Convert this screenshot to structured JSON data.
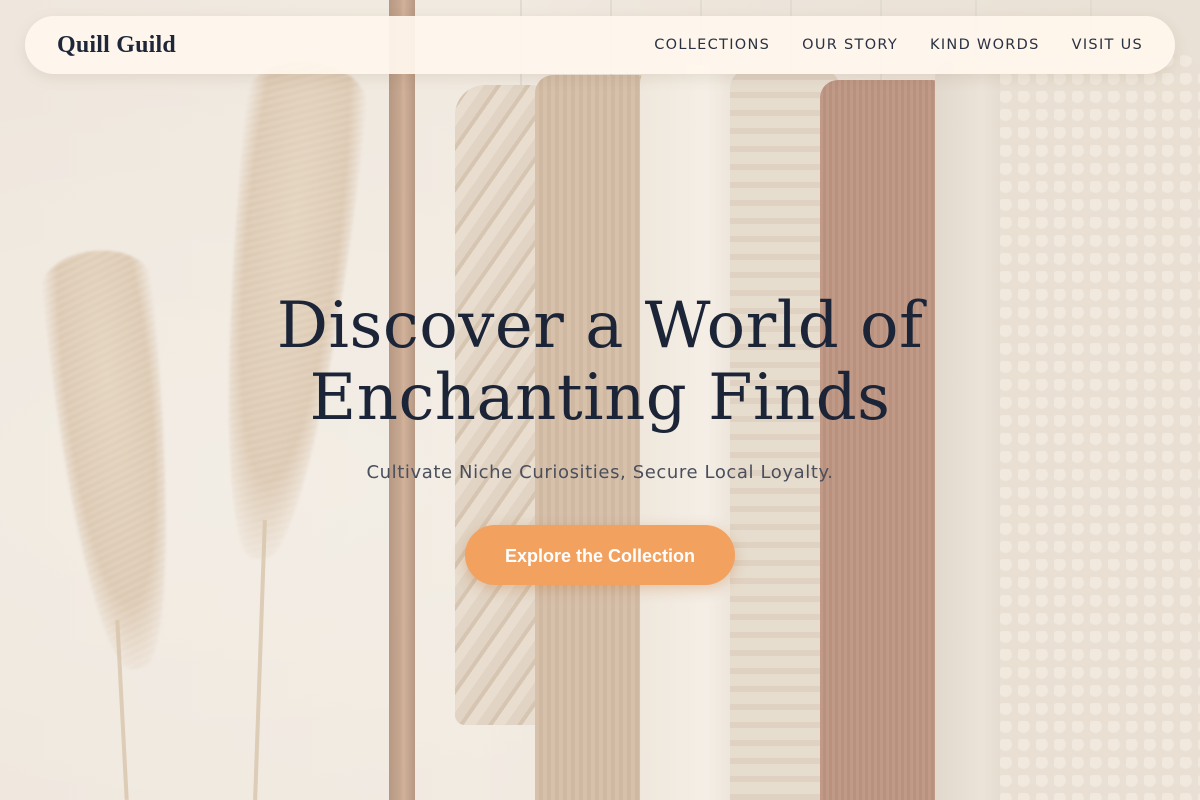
{
  "nav": {
    "brand": "Quill Guild",
    "links": [
      "COLLECTIONS",
      "OUR STORY",
      "KIND WORDS",
      "VISIT US"
    ]
  },
  "hero": {
    "title_line_1": "Discover a World of",
    "title_line_2": "Enchanting Finds",
    "subtitle": "Cultivate Niche Curiosities, Secure Local Loyalty.",
    "cta_label": "Explore the Collection"
  },
  "colors": {
    "accent": "#f2a15f",
    "heading": "#1c2537",
    "nav_background": "#fff6ed"
  }
}
